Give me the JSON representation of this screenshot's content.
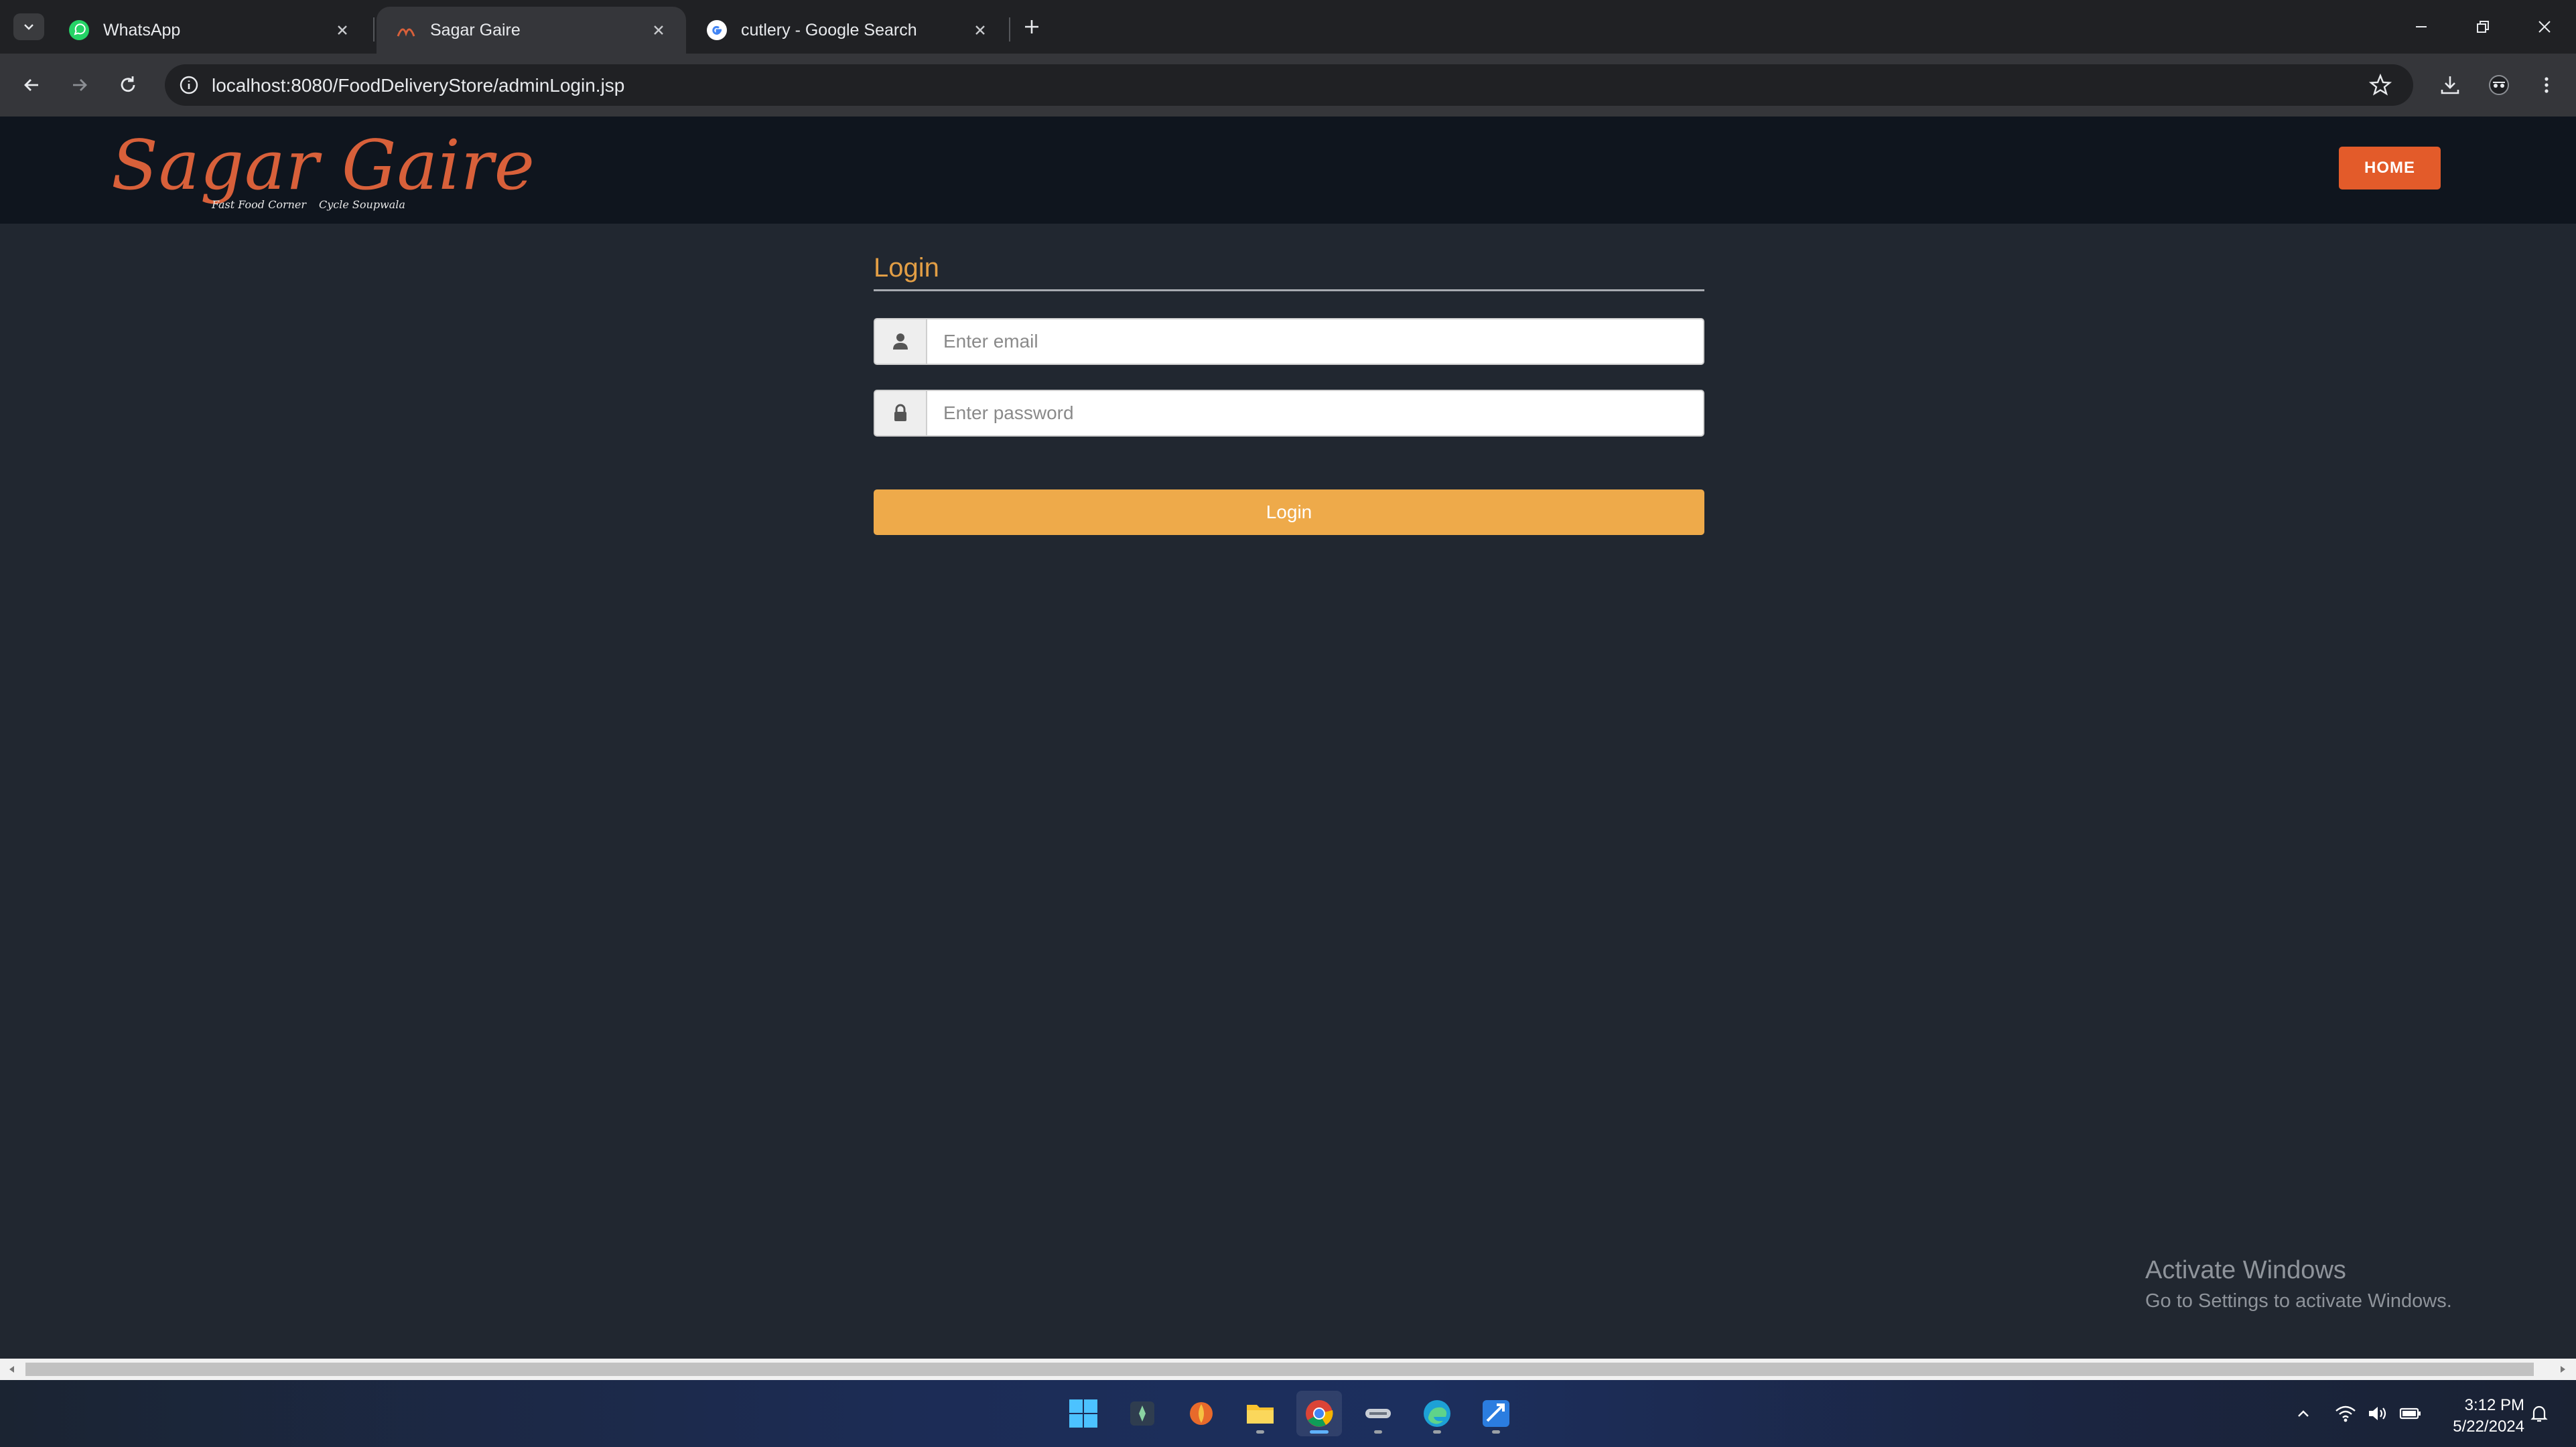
{
  "browser": {
    "tabs": [
      {
        "title": "WhatsApp",
        "icon": "whatsapp-icon"
      },
      {
        "title": "Sagar Gaire",
        "icon": "site-favicon-icon",
        "active": true
      },
      {
        "title": "cutlery - Google Search",
        "icon": "google-icon"
      }
    ],
    "url": "localhost:8080/FoodDeliveryStore/adminLogin.jsp"
  },
  "site": {
    "logo": {
      "name": "Sagar Gaire",
      "tagline_left": "Fast Food Corner",
      "tagline_right": "Cycle Soupwala"
    },
    "nav": {
      "home_label": "HOME"
    }
  },
  "login": {
    "title": "Login",
    "email_placeholder": "Enter email",
    "password_placeholder": "Enter password",
    "submit_label": "Login"
  },
  "watermark": {
    "line1": "Activate Windows",
    "line2": "Go to Settings to activate Windows."
  },
  "taskbar": {
    "apps": [
      "windows-start-icon",
      "app-icon",
      "app-icon",
      "file-explorer-icon",
      "chrome-icon",
      "app-icon",
      "edge-icon",
      "app-icon"
    ],
    "time": "3:12 PM",
    "date": "5/22/2024"
  },
  "colors": {
    "page_bg": "#212730",
    "header_bg": "#0f151e",
    "accent_orange": "#e35b2a",
    "login_button": "#eeaa4a",
    "login_title": "#e29e45"
  }
}
